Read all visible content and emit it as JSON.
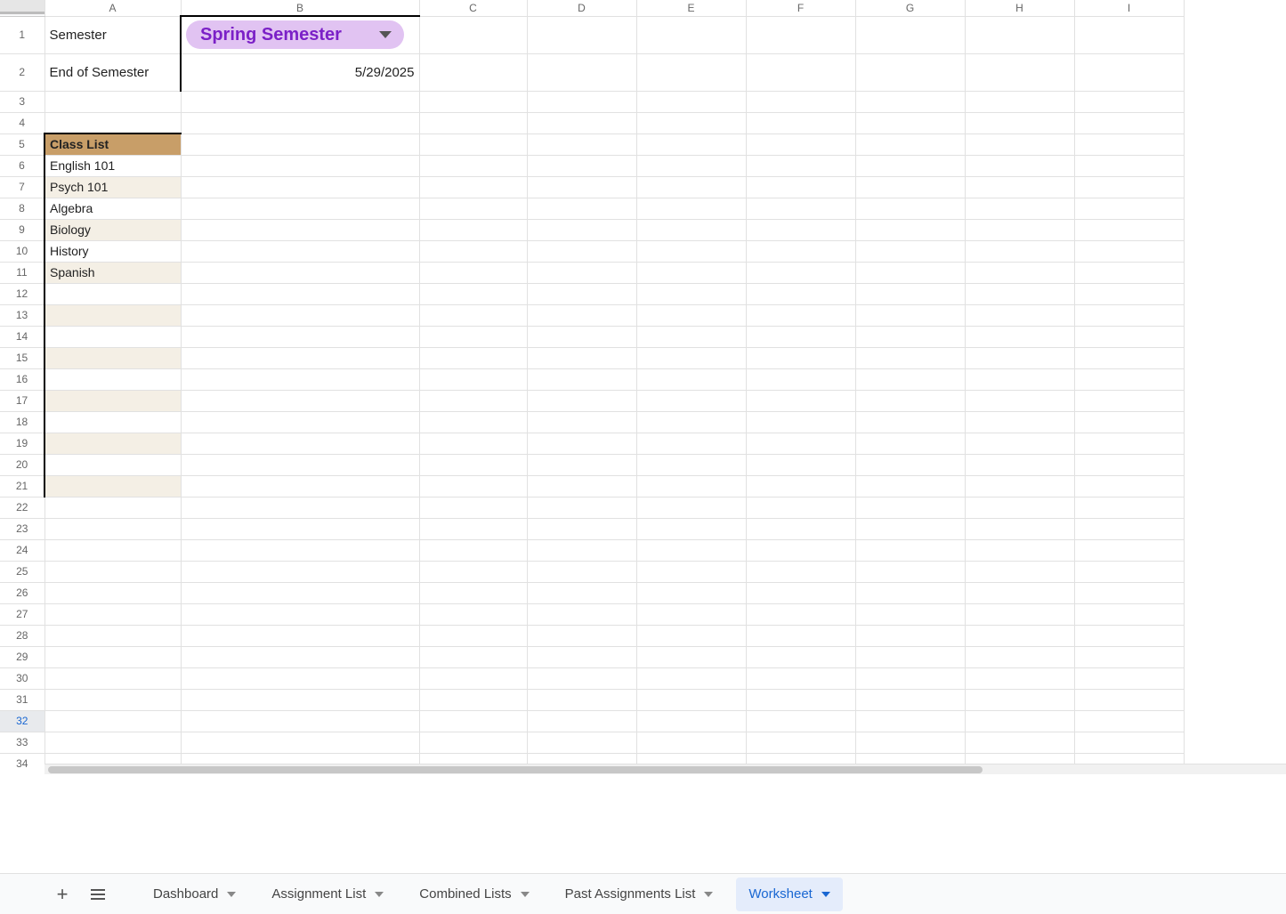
{
  "columns": [
    "A",
    "B",
    "C",
    "D",
    "E",
    "F",
    "G",
    "H",
    "I"
  ],
  "cells": {
    "A1": "Semester",
    "A2": "End of Semester",
    "B2": "5/29/2025",
    "A5": "Class List",
    "A6": "English 101",
    "A7": "Psych 101",
    "A8": "Algebra",
    "A9": "Biology",
    "A10": "History",
    "A11": "Spanish"
  },
  "dropdown": {
    "B1": "Spring Semester"
  },
  "selected_row": 32,
  "visible_rows": 34,
  "tabs": {
    "items": [
      {
        "label": "Dashboard",
        "active": false
      },
      {
        "label": "Assignment List",
        "active": false
      },
      {
        "label": "Combined Lists",
        "active": false
      },
      {
        "label": "Past Assignments List",
        "active": false
      },
      {
        "label": "Worksheet",
        "active": true
      }
    ]
  }
}
